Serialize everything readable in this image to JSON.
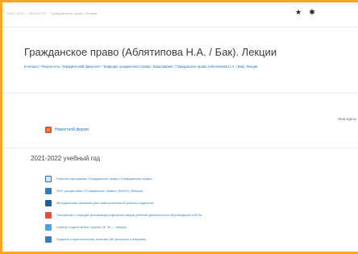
{
  "browser": {
    "tab_text": "2021-2022 · 2021/07/17 · Гражданское право Лекции",
    "icons": [
      "star-icon",
      "extensions-icon"
    ]
  },
  "course": {
    "title": "Гражданское право (Аблятипова Н.А. / Бак). Лекции",
    "breadcrumb": [
      "В начало",
      "Факультеты",
      "Юридический факультет",
      "Кафедра гражданского права",
      "Бакалавриат",
      "Гражданское право (Аблятипова Н.А. / Бак). Лекции"
    ],
    "right_link": "Мои курсы",
    "news_link": "Новостной форум"
  },
  "section": {
    "title": "2021-2022 учебный год",
    "items": [
      {
        "icon": "file",
        "label": "Рабочая программа «Гражданское право» (Гражданское право)"
      },
      {
        "icon": "quiz",
        "label": "ФОС дисциплины «Гражданское право» (ЗачОт) (Лекции)"
      },
      {
        "icon": "assign",
        "label": "Методические указания для самостоятельной работы студентов"
      },
      {
        "icon": "pdf",
        "label": "Положение о порядке реализации отдельных видов учебной деятельности обучающихся в ВУЗе"
      },
      {
        "icon": "blue",
        "label": "Список студентов бак. группы (Ф. Ф) — лекции"
      },
      {
        "icon": "link",
        "label": "Задание к практическому занятию №1 (вопросы к лекциям)"
      }
    ]
  }
}
